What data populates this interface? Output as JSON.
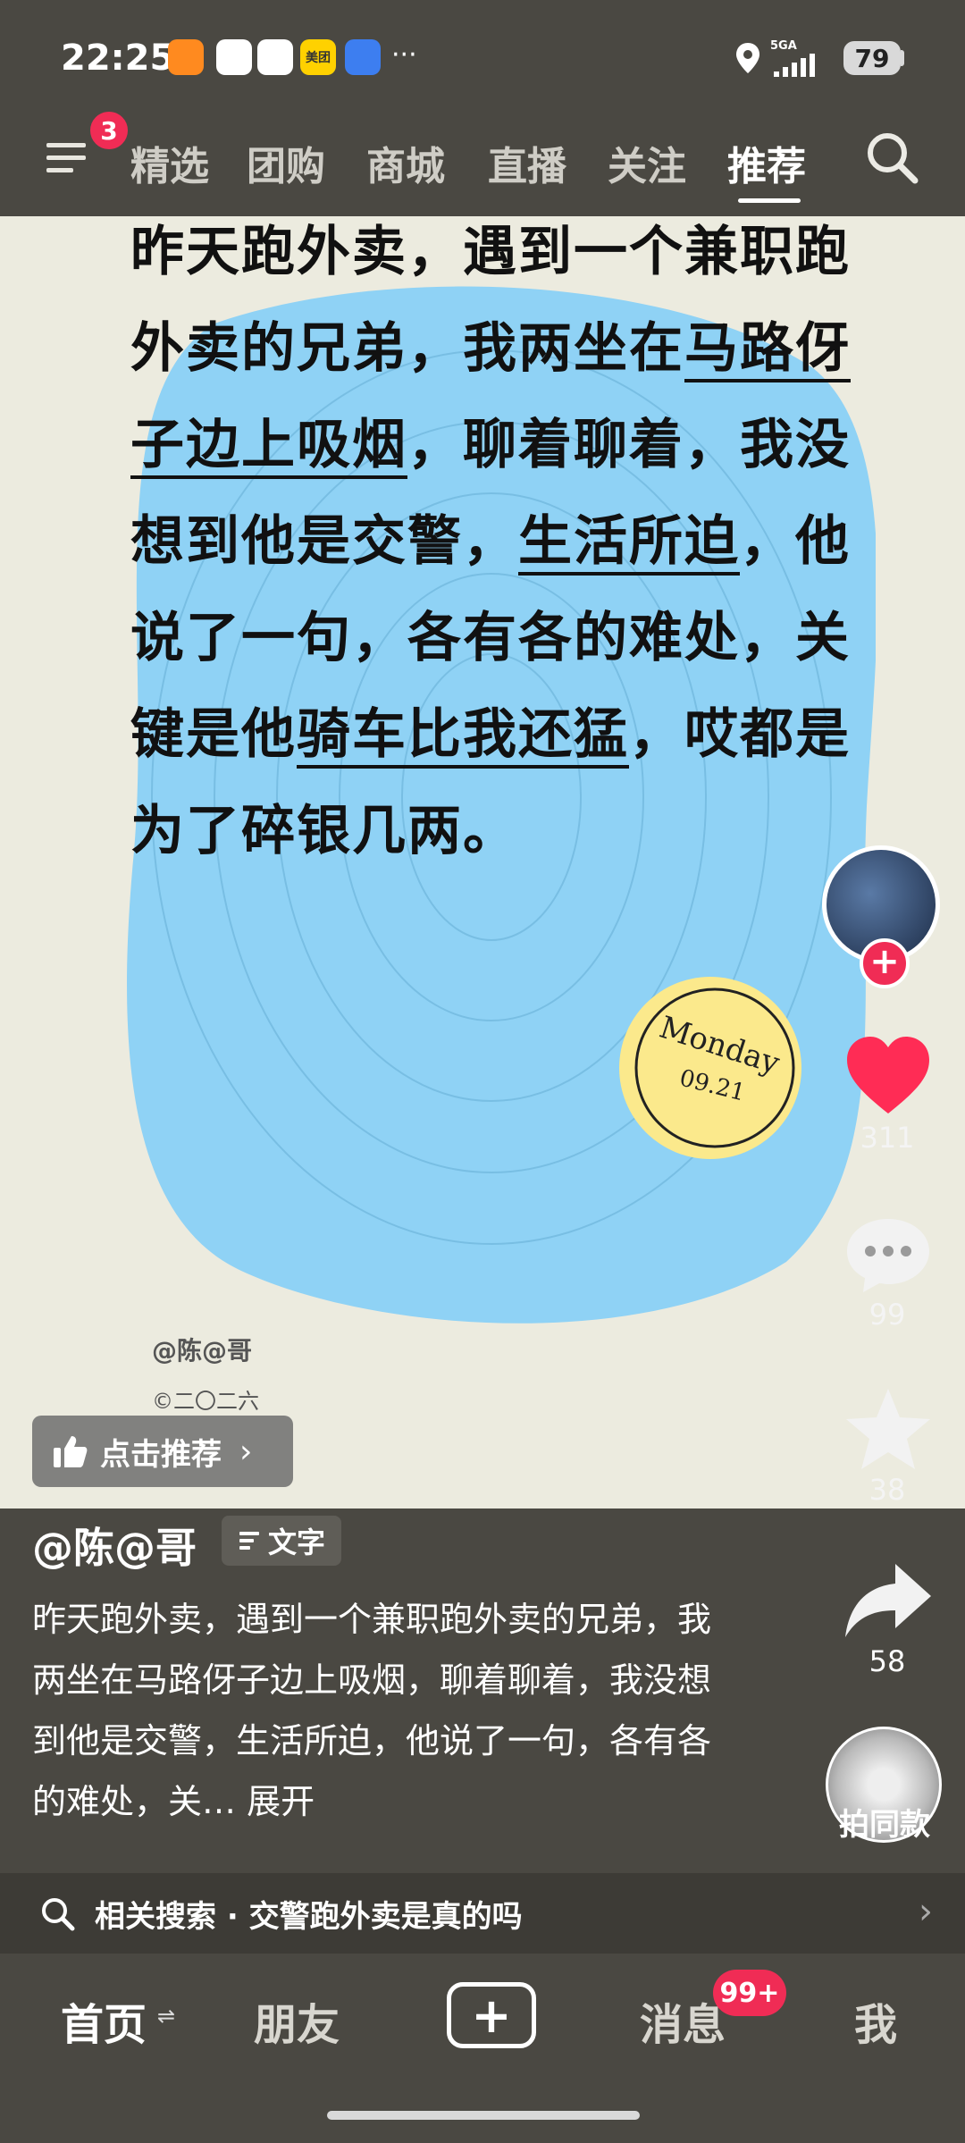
{
  "status_bar": {
    "time": "22:25",
    "app_icons": [
      {
        "name": "taobao-icon",
        "label": "",
        "color": "#ff8a1f"
      },
      {
        "name": "battery-saver-icon",
        "label": "",
        "color": "#ffffff"
      },
      {
        "name": "browser-icon",
        "label": "",
        "color": "#ffffff"
      },
      {
        "name": "meituan-icon",
        "label": "美团",
        "color": "#ffd100"
      },
      {
        "name": "shield-app-icon",
        "label": "",
        "color": "#3d7ef0"
      }
    ],
    "more": "···",
    "network": "5GA",
    "battery": "79"
  },
  "top_nav": {
    "menu_badge": "3",
    "tabs": [
      "精选",
      "团购",
      "商城",
      "直播",
      "关注",
      "推荐"
    ],
    "active_tab": "推荐"
  },
  "post": {
    "segments": [
      {
        "t": "昨天跑外卖，遇到一个兼职跑外卖的兄弟，我两坐在",
        "u": false
      },
      {
        "t": "马路伢子边上",
        "u": true
      },
      {
        "t": "吸烟",
        "u": true
      },
      {
        "t": "，聊着聊着，我没想到他是交警，",
        "u": false
      },
      {
        "t": "生活所迫",
        "u": true
      },
      {
        "t": "，他说了一句，各有各的难处，关键是他",
        "u": false
      },
      {
        "t": "骑车比我还猛",
        "u": true
      },
      {
        "t": "，哎都是为了碎银几两。",
        "u": false
      }
    ],
    "sticker_day": "Monday",
    "sticker_date": "09.21",
    "watermark_name": "@陈@哥",
    "watermark_year": "©二〇二六",
    "recommend_label": "点击推荐",
    "recommend_arrow": "›",
    "colors": {
      "blob": "#8fd2f5",
      "sticker": "#fbe98c",
      "like": "#ff2c55"
    }
  },
  "actions": {
    "follow": "+",
    "likes": "311",
    "comments": "99",
    "favorites": "38",
    "shares": "58",
    "same_style": "拍同款"
  },
  "caption": {
    "author": "@陈@哥",
    "tag": "文字",
    "text": "昨天跑外卖，遇到一个兼职跑外卖的兄弟，我两坐在马路伢子边上吸烟，聊着聊着，我没想到他是交警，生活所迫，他说了一句，各有各的难处，关… ",
    "expand": "展开"
  },
  "related_search": {
    "text": "相关搜索 · 交警跑外卖是真的吗",
    "arrow": "›"
  },
  "bottom_nav": {
    "home": "首页",
    "home_refresh": "⇌",
    "friends": "朋友",
    "create": "+",
    "messages": "消息",
    "messages_badge": "99+",
    "me": "我"
  }
}
